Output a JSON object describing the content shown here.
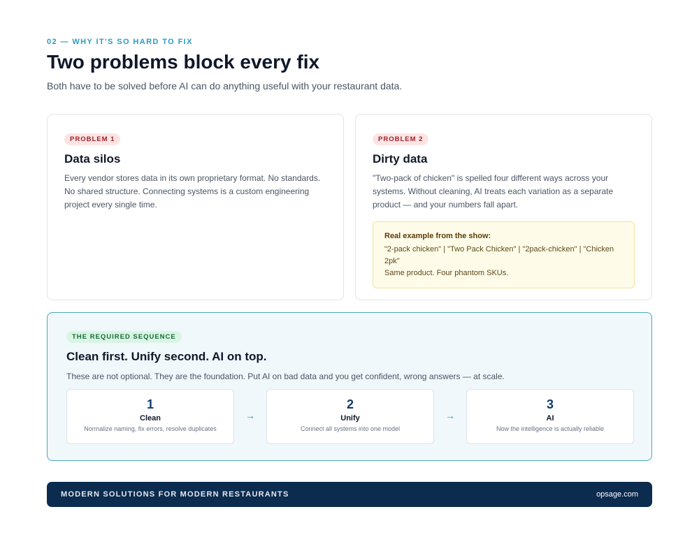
{
  "header": {
    "eyebrow": "02 — WHY IT'S SO HARD TO FIX",
    "title": "Two problems block every fix",
    "subtitle": "Both have to be solved before AI can do anything useful with your restaurant data."
  },
  "problems": [
    {
      "badge": "PROBLEM 1",
      "title": "Data silos",
      "body": "Every vendor stores data in its own proprietary format. No standards. No shared structure. Connecting systems is a custom engineering project every single time."
    },
    {
      "badge": "PROBLEM 2",
      "title": "Dirty data",
      "body": "\"Two-pack of chicken\" is spelled four different ways across your systems. Without cleaning, AI treats each variation as a separate product — and your numbers fall apart.",
      "callout": {
        "title": "Real example from the show:",
        "variants": "\"2-pack chicken\"  |  \"Two Pack Chicken\"  |  \"2pack-chicken\"  |  \"Chicken 2pk\"",
        "note": "Same product. Four phantom SKUs."
      }
    }
  ],
  "sequence": {
    "badge": "THE REQUIRED SEQUENCE",
    "title": "Clean first. Unify second. AI on top.",
    "description": "These are not optional. They are the foundation. Put AI on bad data and you get confident, wrong answers — at scale.",
    "arrow": "→",
    "steps": [
      {
        "num": "1",
        "name": "Clean",
        "desc": "Normalize naming, fix errors, resolve duplicates"
      },
      {
        "num": "2",
        "name": "Unify",
        "desc": "Connect all systems into one model"
      },
      {
        "num": "3",
        "name": "AI",
        "desc": "Now the intelligence is actually reliable"
      }
    ]
  },
  "footer": {
    "brand": "MODERN SOLUTIONS FOR MODERN RESTAURANTS",
    "site": "opsage.com"
  },
  "colors": {
    "accent": "#2a9cc0",
    "navy": "#0b2b4f",
    "problem_badge_bg": "#fde4e4",
    "sequence_badge_bg": "#d9f5e3",
    "callout_bg": "#fefbe8"
  }
}
